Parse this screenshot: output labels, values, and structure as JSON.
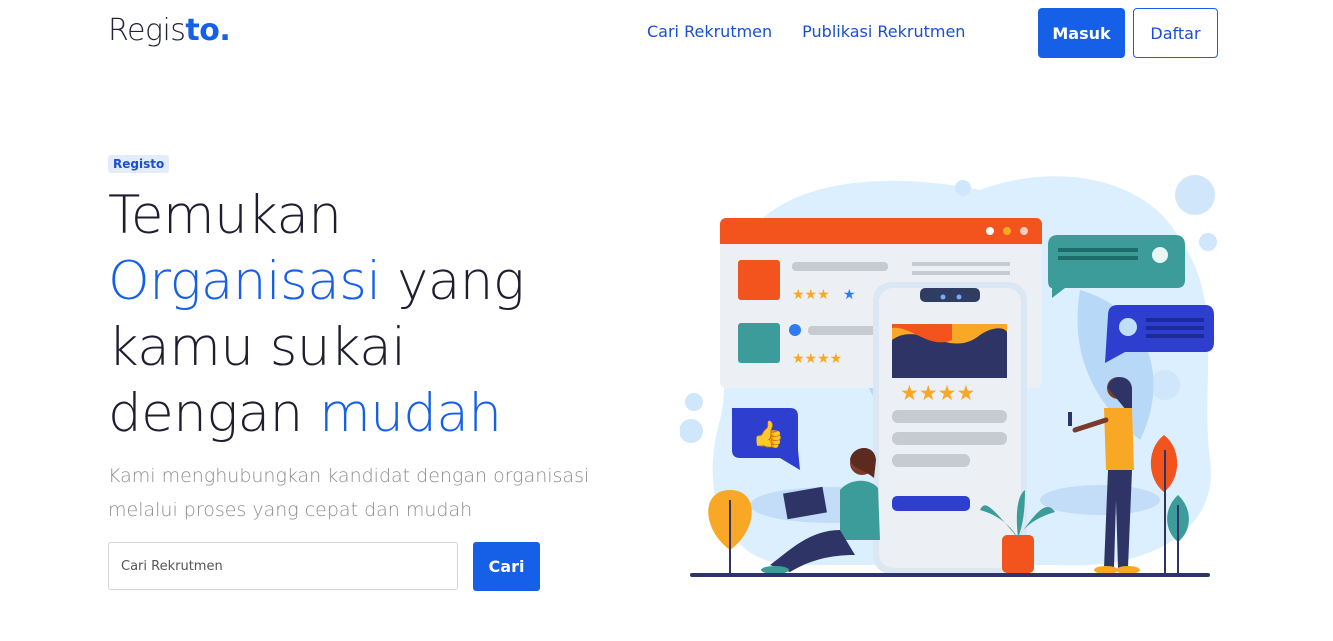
{
  "logo": {
    "main": "Regis",
    "accent": "to."
  },
  "nav": {
    "links": [
      "Cari Rekrutmen",
      "Publikasi Rekrutmen"
    ],
    "login_label": "Masuk",
    "register_label": "Daftar"
  },
  "hero": {
    "badge": "Registo",
    "headline": {
      "l1": "Temukan",
      "l2_blue": "Organisasi",
      "l2_rest": " yang",
      "l3": "kamu sukai",
      "l4_start": "dengan ",
      "l4_blue": "mudah"
    },
    "subtitle": "Kami menghubungkan kandidat dengan organisasi melalui proses yang cepat dan mudah"
  },
  "search": {
    "placeholder": "Cari Rekrutmen",
    "button_label": "Cari"
  },
  "colors": {
    "primary": "#1660e8",
    "dark": "#1e1e30",
    "muted": "#8b8b95"
  },
  "illustration": {
    "icon": "recruitment-illustration"
  }
}
